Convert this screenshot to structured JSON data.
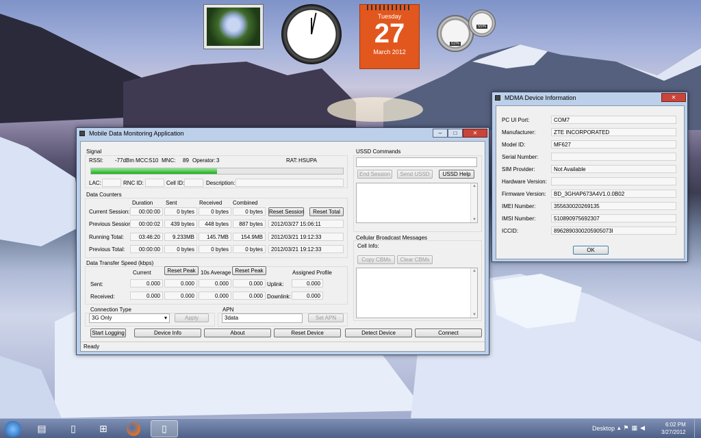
{
  "calendar": {
    "weekday": "Tuesday",
    "day": "27",
    "month_year": "March 2012"
  },
  "meter": {
    "cpu": "02%",
    "ram": "55%"
  },
  "main_window": {
    "title": "Mobile Data Monitoring Application",
    "signal": {
      "group": "Signal",
      "rssi_label": "RSSI:",
      "rssi": "-77dBm",
      "mcc_label": "MCC:",
      "mcc": "510",
      "mnc_label": "MNC:",
      "mnc": "89",
      "operator_label": "Operator:",
      "operator": "3",
      "rat_label": "RAT:",
      "rat": "HSUPA",
      "strength": 0.5,
      "lac_label": "LAC:",
      "rnc_label": "RNC ID:",
      "cell_label": "Cell ID:",
      "desc_label": "Description:"
    },
    "counters": {
      "group": "Data Counters",
      "headers": [
        "Duration",
        "Sent",
        "Received",
        "Combined"
      ],
      "rows": [
        {
          "label": "Current Session:",
          "duration": "00:00:00",
          "sent": "0 bytes",
          "received": "0 bytes",
          "combined": "0 bytes",
          "stamp": ""
        },
        {
          "label": "Previous Session:",
          "duration": "00:00:02",
          "sent": "439 bytes",
          "received": "448 bytes",
          "combined": "887 bytes",
          "stamp": "2012/03/27 15:06:11"
        },
        {
          "label": "Running Total:",
          "duration": "03:46:20",
          "sent": "9.233MB",
          "received": "145.7MB",
          "combined": "154.9MB",
          "stamp": "2012/03/21 19:12:33"
        },
        {
          "label": "Previous Total:",
          "duration": "00:00:00",
          "sent": "0 bytes",
          "received": "0 bytes",
          "combined": "0 bytes",
          "stamp": "2012/03/21 19:12:33"
        }
      ],
      "reset_session": "Reset Session",
      "reset_total": "Reset Total"
    },
    "speed": {
      "group": "Data Transfer Speed (kbps)",
      "current": "Current",
      "reset_peak": "Reset Peak",
      "avg": "10s Average",
      "assigned": "Assigned Profile",
      "sent_label": "Sent:",
      "received_label": "Received:",
      "uplink_label": "Uplink:",
      "downlink_label": "Downlink:",
      "sent": [
        "0.000",
        "0.000",
        "0.000",
        "0.000"
      ],
      "received": [
        "0.000",
        "0.000",
        "0.000",
        "0.000"
      ],
      "uplink": "0.000",
      "downlink": "0.000"
    },
    "conn": {
      "group": "Connection Type",
      "value": "3G Only",
      "apply": "Apply"
    },
    "apn": {
      "group": "APN",
      "value": "3data",
      "set": "Set APN"
    },
    "ussd": {
      "group": "USSD Commands",
      "end": "End Session",
      "send": "Send USSD",
      "help": "USSD Help"
    },
    "cbm": {
      "group": "Cellular Broadcast Messages",
      "cell_info": "Cell Info:",
      "copy": "Copy CBMs",
      "clear": "Clear CBMs"
    },
    "buttons": {
      "logging": "Start Logging",
      "device_info": "Device Info",
      "about": "About",
      "reset_device": "Reset Device",
      "detect": "Detect Device",
      "connect": "Connect"
    },
    "status": "Ready"
  },
  "info_window": {
    "title": "MDMA Device Information",
    "rows": [
      {
        "label": "PC UI Port:",
        "value": "COM7"
      },
      {
        "label": "Manufacturer:",
        "value": "ZTE INCORPORATED"
      },
      {
        "label": "Model ID:",
        "value": "MF627"
      },
      {
        "label": "Serial Number:",
        "value": ""
      },
      {
        "label": "SIM Provider:",
        "value": "Not Available"
      },
      {
        "label": "Hardware Version:",
        "value": ""
      },
      {
        "label": "Firmware Version:",
        "value": "BD_3GHAP673A4V1.0.0B02"
      },
      {
        "label": "IMEI Number:",
        "value": "355630020269135"
      },
      {
        "label": "IMSI Number:",
        "value": "510890975692307"
      },
      {
        "label": "ICCID:",
        "value": "8962890300205905073l"
      }
    ],
    "ok": "OK"
  },
  "taskbar": {
    "desktop": "Desktop",
    "time": "6:02 PM",
    "date": "3/27/2012"
  }
}
